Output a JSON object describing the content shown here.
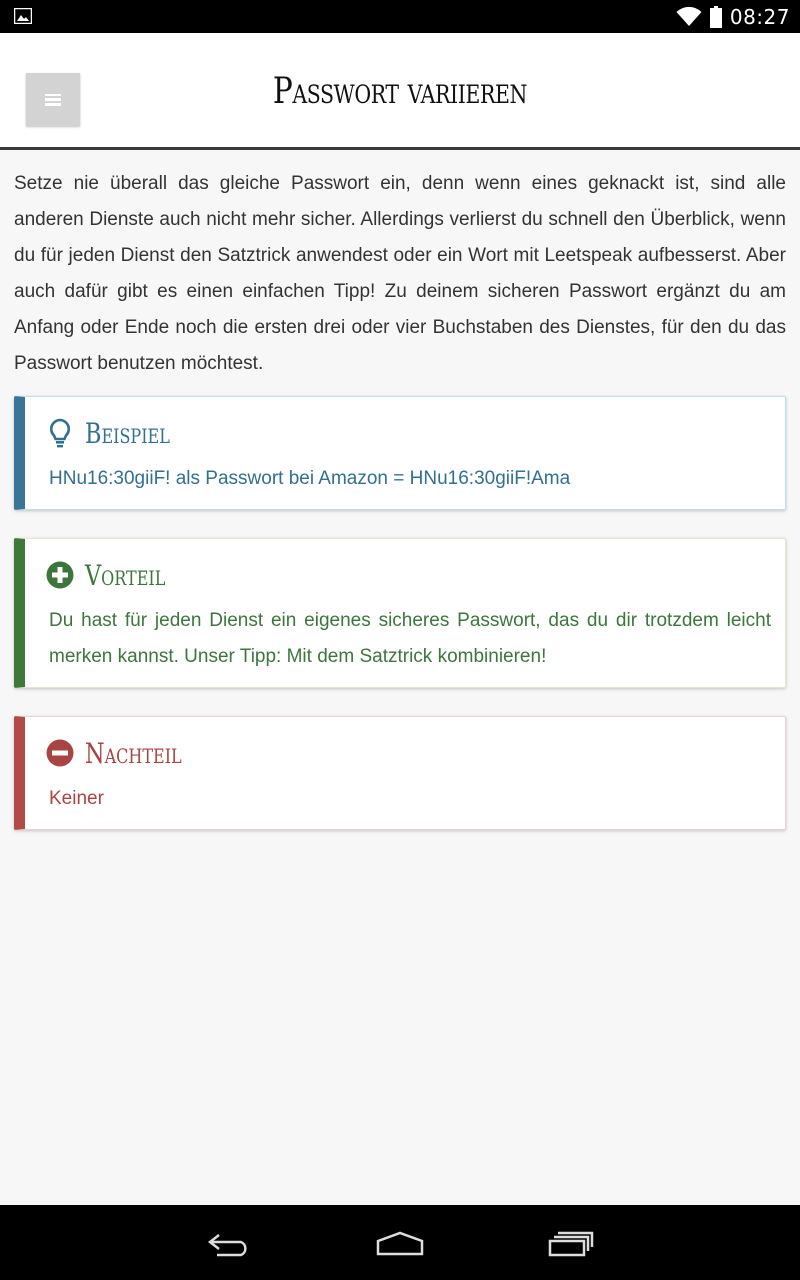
{
  "status_bar": {
    "time": "08:27",
    "icons": [
      "image-icon",
      "wifi-icon",
      "battery-icon"
    ]
  },
  "header": {
    "title": "Passwort variieren",
    "menu_icon": "hamburger-menu-icon"
  },
  "intro": "Setze nie überall das gleiche Passwort ein, denn wenn eines geknackt ist, sind alle anderen Dienste auch nicht mehr sicher. Allerdings verlierst du schnell den Überblick, wenn du für jeden Dienst den Satztrick anwendest oder ein Wort mit Leetspeak aufbesserst. Aber auch dafür gibt es einen einfachen Tipp! Zu deinem sicheren Passwort ergänzt du am Anfang oder Ende noch die ersten drei oder vier Buchstaben des Dienstes, für den du das Passwort benutzen möchtest.",
  "cards": [
    {
      "title": "Beispiel",
      "icon": "lightbulb-icon",
      "text": "HNu16:30giiF! als Passwort bei Amazon = HNu16:30giiF!Ama",
      "color": "#31708f"
    },
    {
      "title": "Vorteil",
      "icon": "plus-circle-icon",
      "text": "Du hast für jeden Dienst ein eigenes sicheres Passwort, das du dir trotzdem leicht merken kannst. Unser Tipp: Mit dem Satztrick kombinieren!",
      "color": "#3c763d"
    },
    {
      "title": "Nachteil",
      "icon": "minus-circle-icon",
      "text": "Keiner",
      "color": "#a94442"
    }
  ],
  "nav_bar": {
    "buttons": [
      "back-icon",
      "home-icon",
      "recent-apps-icon"
    ]
  }
}
